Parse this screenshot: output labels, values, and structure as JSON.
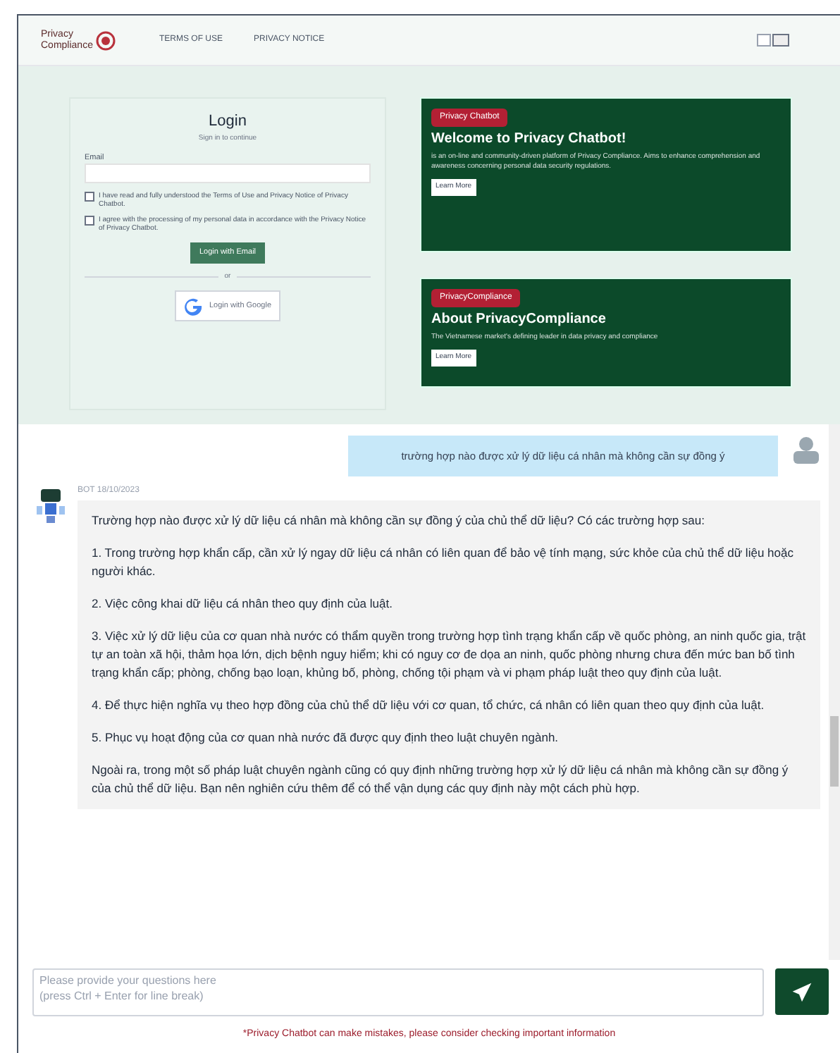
{
  "header": {
    "logo": {
      "line_1": "Privacy",
      "line_2": "Compliance"
    },
    "nav": [
      "TERMS OF USE",
      "PRIVACY NOTICE"
    ]
  },
  "login": {
    "title": "Login",
    "subtitle": "Sign in to continue",
    "email_label": "Email",
    "consents": [
      {
        "text": "I have read and fully understood the Terms of Use and Privacy Notice of Privacy Chatbot.",
        "checked": false
      },
      {
        "text": "I agree with the processing of my personal data in accordance with the Privacy Notice of Privacy Chatbot.",
        "checked": false
      }
    ],
    "email_button": "Login with Email",
    "divider": "or",
    "google_button": "Login with Google"
  },
  "cards": [
    {
      "badge": "Privacy Chatbot",
      "title": "Welcome to Privacy Chatbot!",
      "text": "is an on-line and community-driven platform of Privacy Compliance. Aims to enhance comprehension and awareness concerning personal data security regulations.",
      "button": "Learn More"
    },
    {
      "badge": "PrivacyCompliance",
      "title": "About PrivacyCompliance",
      "text": "The Vietnamese market's defining leader in data privacy and compliance",
      "button": "Learn More"
    }
  ],
  "chat": {
    "messages": [
      {
        "kind": "user",
        "paragraphs": [
          "trường hợp nào được xử lý dữ liệu cá nhân mà không cần sự đồng ý"
        ]
      },
      {
        "kind": "bot",
        "sender": "BOT 18/10/2023",
        "paragraphs": [
          "Trường hợp nào được xử lý dữ liệu cá nhân mà không cần sự đồng ý của chủ thể dữ liệu? Có các trường hợp sau:",
          "1. Trong trường hợp khẩn cấp, cần xử lý ngay dữ liệu cá nhân có liên quan để bảo vệ tính mạng, sức khỏe của chủ thể dữ liệu hoặc người khác.",
          "2. Việc công khai dữ liệu cá nhân theo quy định của luật.",
          "3. Việc xử lý dữ liệu của cơ quan nhà nước có thẩm quyền trong trường hợp tình trạng khẩn cấp về quốc phòng, an ninh quốc gia, trật tự an toàn xã hội, thảm họa lớn, dịch bệnh nguy hiểm; khi có nguy cơ đe dọa an ninh, quốc phòng nhưng chưa đến mức ban bố tình trạng khẩn cấp; phòng, chống bạo loạn, khủng bố, phòng, chống tội phạm và vi phạm pháp luật theo quy định của luật.",
          "4. Để thực hiện nghĩa vụ theo hợp đồng của chủ thể dữ liệu với cơ quan, tổ chức, cá nhân có liên quan theo quy định của luật.",
          "5. Phục vụ hoạt động của cơ quan nhà nước đã được quy định theo luật chuyên ngành.",
          "Ngoài ra, trong một số pháp luật chuyên ngành cũng có quy định những trường hợp xử lý dữ liệu cá nhân mà không cần sự đồng ý của chủ thể dữ liệu. Bạn nên nghiên cứu thêm để có thể vận dụng các quy định này một cách phù hợp."
        ]
      }
    ]
  },
  "composer": {
    "placeholder": "Please provide your questions here\n(press Ctrl + Enter for line break)"
  },
  "disclaimer": "*Privacy Chatbot can make mistakes, please consider checking important information"
}
